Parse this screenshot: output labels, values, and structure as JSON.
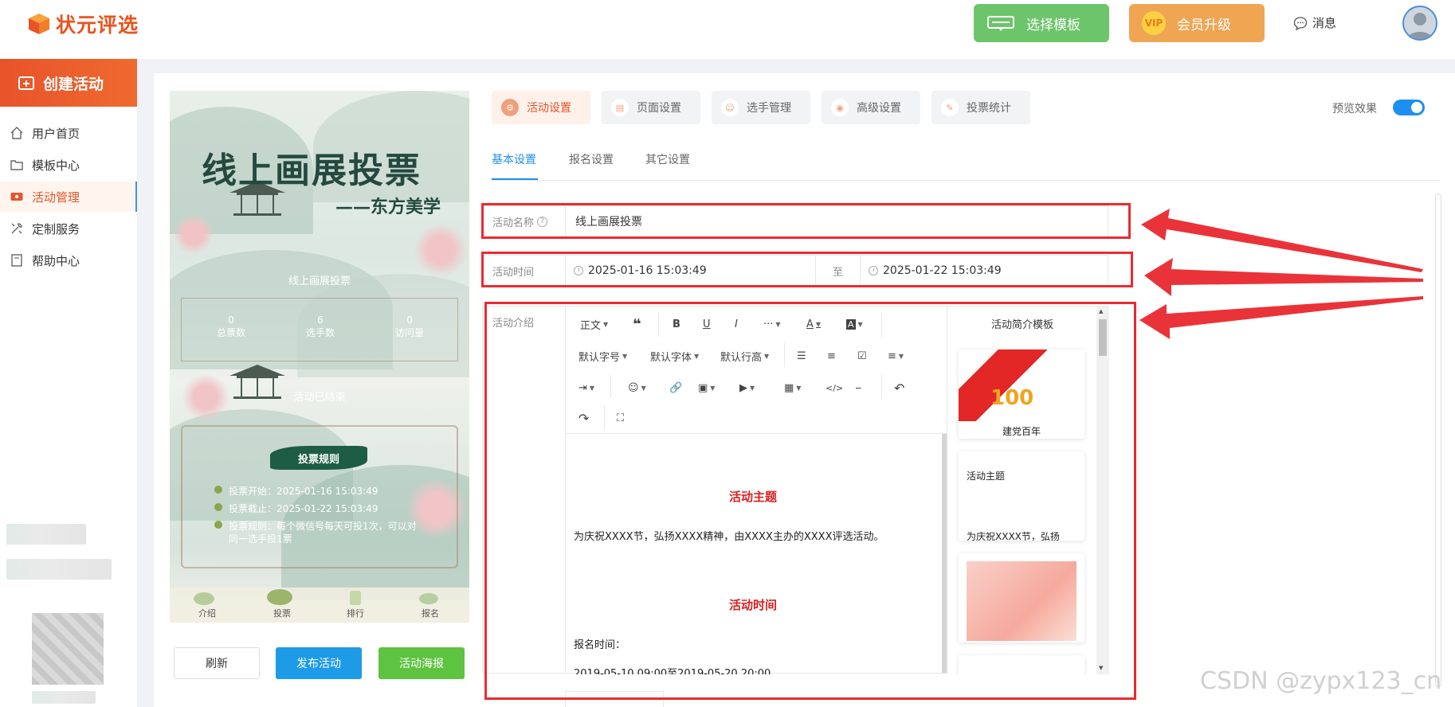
{
  "topbar": {
    "brand": "状元评选",
    "choose_template": "选择模板",
    "vip_badge": "VIP",
    "vip_upgrade": "会员升级",
    "messages": "消息"
  },
  "sidebar": {
    "create": "创建活动",
    "items": [
      {
        "label": "用户首页",
        "icon": "home-icon"
      },
      {
        "label": "模板中心",
        "icon": "folder-icon"
      },
      {
        "label": "活动管理",
        "icon": "ticket-icon"
      },
      {
        "label": "定制服务",
        "icon": "tools-icon"
      },
      {
        "label": "帮助中心",
        "icon": "book-icon"
      }
    ]
  },
  "preview": {
    "title": "线上画展投票",
    "subtitle": "——东方美学",
    "name_line": "线上画展投票",
    "stats": [
      {
        "value": "0",
        "label": "总票数"
      },
      {
        "value": "6",
        "label": "选手数"
      },
      {
        "value": "0",
        "label": "访问量"
      }
    ],
    "status": "活动已结束",
    "rules_button": "投票规则",
    "info": [
      "投票开始：2025-01-16 15:03:49",
      "投票截止：2025-01-22 15:03:49",
      "投票规则：每个微信号每天可投1次，可以对"
    ],
    "info_cont": "同一选手投1票",
    "bottom_nav": [
      "介绍",
      "投票",
      "排行",
      "报名"
    ]
  },
  "actions": {
    "refresh": "刷新",
    "publish": "发布活动",
    "poster": "活动海报"
  },
  "tabs": [
    "活动设置",
    "页面设置",
    "选手管理",
    "高级设置",
    "投票统计"
  ],
  "preview_toggle": {
    "label": "预览效果",
    "on": true
  },
  "subtabs": [
    "基本设置",
    "报名设置",
    "其它设置"
  ],
  "form": {
    "name_label": "活动名称",
    "name_value": "线上画展投票",
    "time_label": "活动时间",
    "time_start": "2025-01-16 15:03:49",
    "time_to": "至",
    "time_end": "2025-01-22 15:03:49",
    "intro_label": "活动介绍"
  },
  "editor": {
    "toolbar": {
      "paragraph": "正文",
      "font_size": "默认字号",
      "font_family": "默认字体",
      "line_height": "默认行高"
    },
    "content": {
      "h1": "活动主题",
      "p1": "为庆祝XXXX节，弘扬XXXX精神，由XXXX主办的XXXX评选活动。",
      "h2": "活动时间",
      "p2": "报名时间：",
      "p3": "2019-05-10 09:00至2019-05-20 20:00"
    },
    "templates_title": "活动简介模板",
    "template_cards": [
      {
        "caption": "建党百年"
      },
      {
        "heading": "活动主题",
        "text": "为庆祝XXXX节，弘扬"
      },
      {
        "caption": ""
      }
    ]
  },
  "watermark": "CSDN @zypx123_cn",
  "colors": {
    "accent": "#e8532a",
    "primary": "#1e8ef0",
    "highlight": "#ea2b2f",
    "green": "#5ec341"
  }
}
